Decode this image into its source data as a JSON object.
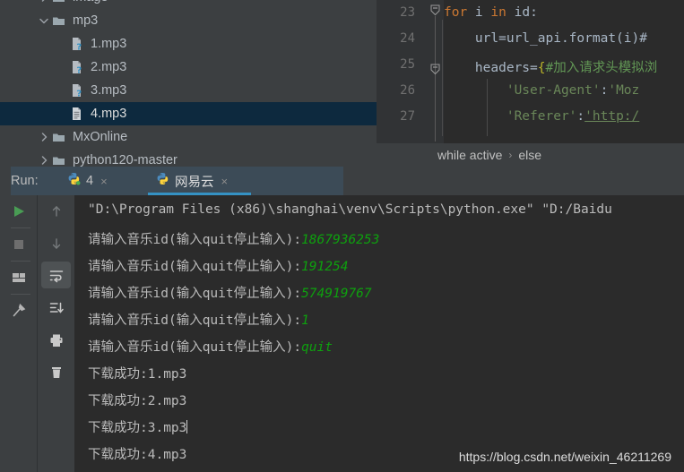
{
  "project_tree": {
    "rows": [
      {
        "label": "image",
        "type": "folder",
        "expanded": false,
        "indent": 1,
        "selected": false,
        "partial": true,
        "icon": "folder-icon"
      },
      {
        "label": "mp3",
        "type": "folder",
        "expanded": true,
        "indent": 1,
        "selected": false,
        "partial": false,
        "icon": "folder-open-icon"
      },
      {
        "label": "1.mp3",
        "type": "unknown-file",
        "expanded": null,
        "indent": 2,
        "selected": false,
        "partial": false,
        "icon": "unknown-file-icon"
      },
      {
        "label": "2.mp3",
        "type": "unknown-file",
        "expanded": null,
        "indent": 2,
        "selected": false,
        "partial": false,
        "icon": "unknown-file-icon"
      },
      {
        "label": "3.mp3",
        "type": "unknown-file",
        "expanded": null,
        "indent": 2,
        "selected": false,
        "partial": false,
        "icon": "unknown-file-icon"
      },
      {
        "label": "4.mp3",
        "type": "text-file",
        "expanded": null,
        "indent": 2,
        "selected": true,
        "partial": false,
        "icon": "text-file-icon"
      },
      {
        "label": "MxOnline",
        "type": "folder",
        "expanded": false,
        "indent": 1,
        "selected": false,
        "partial": false,
        "icon": "folder-icon"
      },
      {
        "label": "python120-master",
        "type": "folder",
        "expanded": false,
        "indent": 1,
        "selected": false,
        "partial": false,
        "icon": "folder-icon"
      }
    ]
  },
  "editor": {
    "line_numbers": [
      "23",
      "24",
      "25",
      "26",
      "27"
    ],
    "code_lines": [
      {
        "n": "23",
        "segments": [
          {
            "t": "for",
            "c": "kw"
          },
          {
            "t": " i ",
            "c": "op"
          },
          {
            "t": "in",
            "c": "kw"
          },
          {
            "t": " id:",
            "c": "op"
          }
        ]
      },
      {
        "n": "24",
        "segments": [
          {
            "t": "    url=url_api.format(i)#",
            "c": "op"
          }
        ]
      },
      {
        "n": "25",
        "segments": [
          {
            "t": "    headers=",
            "c": "op"
          },
          {
            "t": "{",
            "c": "brc"
          },
          {
            "t": "#加入请求头模拟浏",
            "c": "cmt"
          }
        ]
      },
      {
        "n": "26",
        "segments": [
          {
            "t": "        ",
            "c": "op"
          },
          {
            "t": "'User-Agent'",
            "c": "str"
          },
          {
            "t": ":",
            "c": "op"
          },
          {
            "t": "'Moz",
            "c": "str"
          }
        ]
      },
      {
        "n": "27",
        "segments": [
          {
            "t": "        ",
            "c": "op"
          },
          {
            "t": "'Referer'",
            "c": "str"
          },
          {
            "t": ":",
            "c": "op"
          },
          {
            "t": "'http:/",
            "c": "lnk"
          }
        ]
      }
    ],
    "breadcrumb": {
      "items": [
        "while active",
        "else"
      ],
      "separator": "›"
    }
  },
  "run_window": {
    "run_label": "Run:",
    "tabs": [
      {
        "label": "4",
        "icon": "python-running-icon",
        "close": "×",
        "active": false
      },
      {
        "label": "网易云",
        "icon": "python-icon",
        "close": "×",
        "active": true
      }
    ],
    "toolbar_left": [
      {
        "name": "rerun-button",
        "icon": "play-icon",
        "active": false
      },
      {
        "name": "stop-button",
        "icon": "stop-icon",
        "active": false
      },
      {
        "name": "restore-layout-button",
        "icon": "layout-icon",
        "active": false
      },
      {
        "name": "pin-tab-button",
        "icon": "pin-icon",
        "active": false
      }
    ],
    "toolbar_right": [
      {
        "name": "up-the-stack-button",
        "icon": "arrow-up-icon",
        "active": false
      },
      {
        "name": "down-the-stack-button",
        "icon": "arrow-down-icon",
        "active": false
      },
      {
        "name": "soft-wrap-button",
        "icon": "soft-wrap-icon",
        "active": true
      },
      {
        "name": "scroll-to-end-button",
        "icon": "scroll-to-end-icon",
        "active": false
      },
      {
        "name": "print-button",
        "icon": "printer-icon",
        "active": false
      },
      {
        "name": "clear-all-button",
        "icon": "trash-icon",
        "active": false
      }
    ],
    "console": {
      "prompt": "请输入音乐id(输入quit停止输入):",
      "lines": [
        {
          "text": "\"D:\\Program Files (x86)\\shanghai\\venv\\Scripts\\python.exe\" \"D:/Baidu",
          "input": "",
          "caret": false
        },
        {
          "text": "请输入音乐id(输入quit停止输入):",
          "input": "1867936253",
          "caret": false
        },
        {
          "text": "请输入音乐id(输入quit停止输入):",
          "input": "191254",
          "caret": false
        },
        {
          "text": "请输入音乐id(输入quit停止输入):",
          "input": "574919767",
          "caret": false
        },
        {
          "text": "请输入音乐id(输入quit停止输入):",
          "input": "1",
          "caret": false
        },
        {
          "text": "请输入音乐id(输入quit停止输入):",
          "input": "quit",
          "caret": false
        },
        {
          "text": "下载成功:1.mp3",
          "input": "",
          "caret": false
        },
        {
          "text": "下载成功:2.mp3",
          "input": "",
          "caret": false
        },
        {
          "text": "下载成功:3.mp3",
          "input": "",
          "caret": true
        },
        {
          "text": "下载成功:4.mp3",
          "input": "",
          "caret": false
        }
      ]
    }
  },
  "watermark": "https://blog.csdn.net/weixin_46211269",
  "colors": {
    "selection": "#0d293e",
    "tab_accent": "#3592c4",
    "console_bg": "#2b2b2b",
    "panel_bg": "#3c3f41",
    "keyword": "#cc7832",
    "string": "#6a8759",
    "comment": "#629755",
    "console_input": "#0ea00e",
    "run_green": "#499c54"
  }
}
